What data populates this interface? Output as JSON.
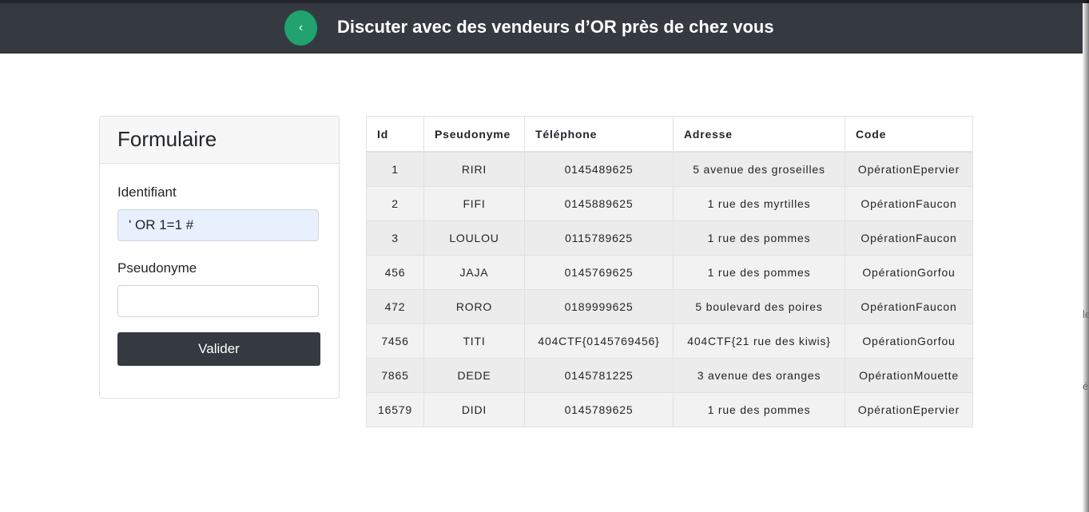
{
  "navbar": {
    "back_symbol": "‹",
    "title": "Discuter avec des vendeurs d’OR près de chez vous"
  },
  "form": {
    "title": "Formulaire",
    "identifiant_label": "Identifiant",
    "identifiant_value": "' OR 1=1 #",
    "pseudonyme_label": "Pseudonyme",
    "pseudonyme_value": "",
    "submit_label": "Valider"
  },
  "table": {
    "columns": [
      "Id",
      "Pseudonyme",
      "Téléphone",
      "Adresse",
      "Code"
    ],
    "rows": [
      [
        "1",
        "RIRI",
        "0145489625",
        "5 avenue des groseilles",
        "OpérationEpervier"
      ],
      [
        "2",
        "FIFI",
        "0145889625",
        "1 rue des myrtilles",
        "OpérationFaucon"
      ],
      [
        "3",
        "LOULOU",
        "0115789625",
        "1 rue des pommes",
        "OpérationFaucon"
      ],
      [
        "456",
        "JAJA",
        "0145769625",
        "1 rue des pommes",
        "OpérationGorfou"
      ],
      [
        "472",
        "RORO",
        "0189999625",
        "5 boulevard des poires",
        "OpérationFaucon"
      ],
      [
        "7456",
        "TITI",
        "404CTF{0145769456}",
        "404CTF{21 rue des kiwis}",
        "OpérationGorfou"
      ],
      [
        "7865",
        "DEDE",
        "0145781225",
        "3 avenue des oranges",
        "OpérationMouette"
      ],
      [
        "16579",
        "DIDI",
        "0145789625",
        "1 rue des pommes",
        "OpérationEpervier"
      ]
    ]
  },
  "side_fragments": [
    "le",
    "é"
  ]
}
